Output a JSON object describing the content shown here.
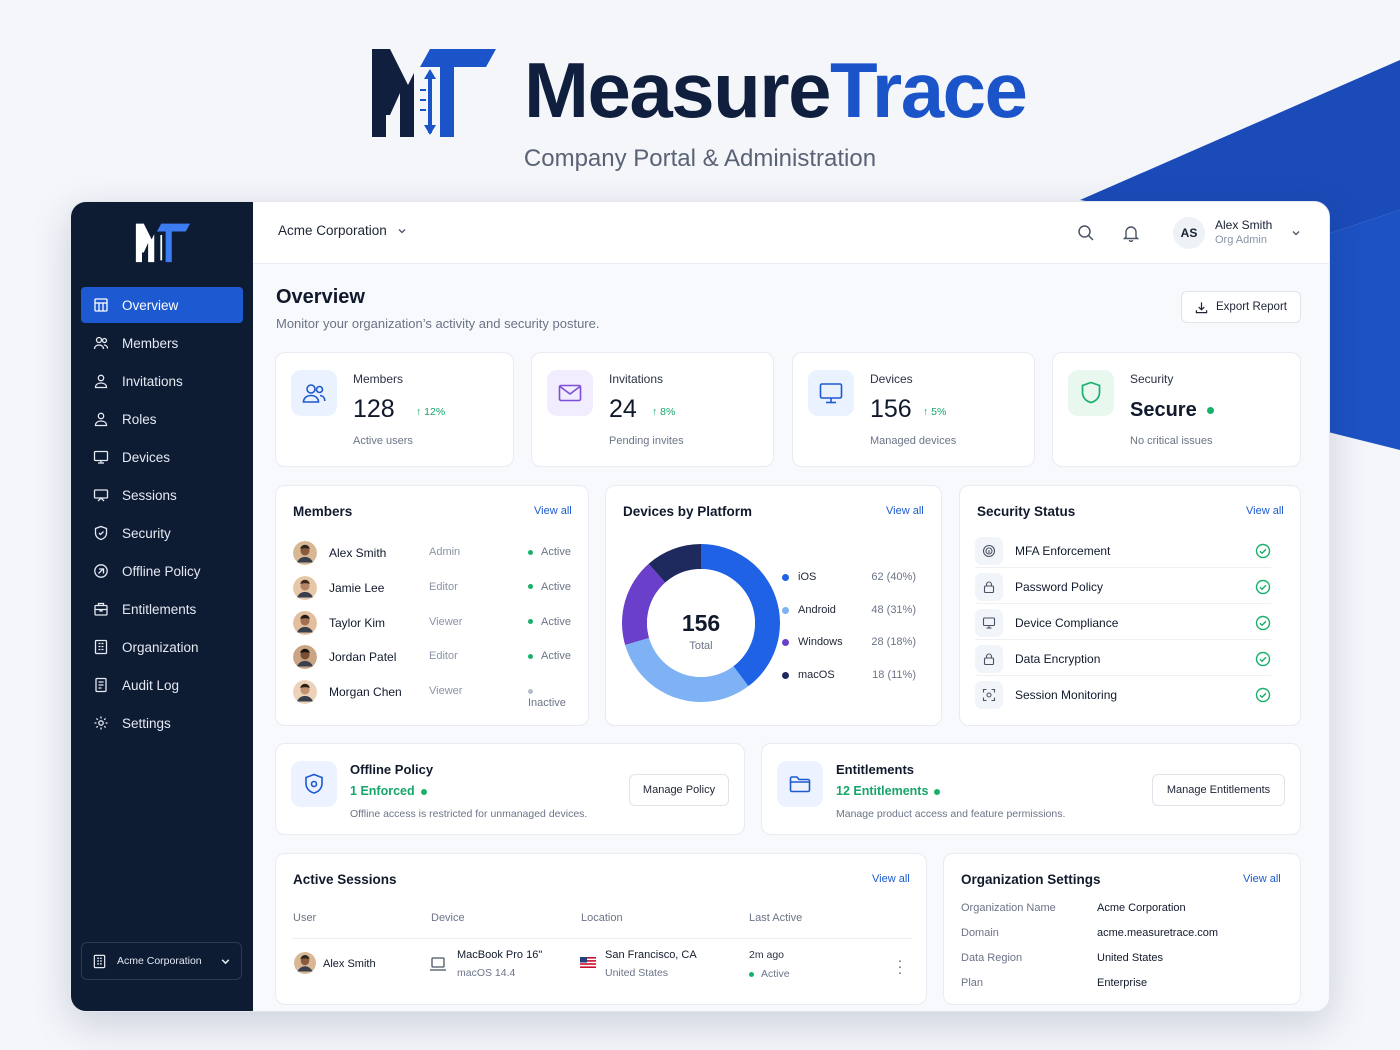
{
  "brand": {
    "name_part1": "Measure",
    "name_part2": "Trace",
    "tagline": "Company Portal & Administration"
  },
  "colors": {
    "brand_navy": "#0f1f3d",
    "brand_blue": "#1b54c9",
    "sidebar_bg": "#0d1b33",
    "active_nav": "#1d5ad1",
    "success": "#18b06b"
  },
  "sidebar": {
    "items": [
      {
        "label": "Overview",
        "icon": "grid-icon",
        "active": true
      },
      {
        "label": "Members",
        "icon": "users-icon"
      },
      {
        "label": "Invitations",
        "icon": "user-plus-icon"
      },
      {
        "label": "Roles",
        "icon": "user-icon"
      },
      {
        "label": "Devices",
        "icon": "monitor-icon"
      },
      {
        "label": "Sessions",
        "icon": "session-icon"
      },
      {
        "label": "Security",
        "icon": "shield-icon"
      },
      {
        "label": "Offline Policy",
        "icon": "offline-icon"
      },
      {
        "label": "Entitlements",
        "icon": "package-icon"
      },
      {
        "label": "Organization",
        "icon": "building-icon"
      },
      {
        "label": "Audit Log",
        "icon": "log-icon"
      },
      {
        "label": "Settings",
        "icon": "gear-icon"
      }
    ],
    "org_switcher": "Acme Corporation"
  },
  "topbar": {
    "org": "Acme Corporation",
    "user_initials": "AS",
    "user_name": "Alex Smith",
    "user_role": "Org Admin"
  },
  "page": {
    "title": "Overview",
    "subtitle": "Monitor your organization’s activity and security posture.",
    "export_label": "Export Report"
  },
  "stats": [
    {
      "label": "Members",
      "value": "128",
      "delta": "12%",
      "note": "Active users"
    },
    {
      "label": "Invitations",
      "value": "24",
      "delta": "8%",
      "note": "Pending invites"
    },
    {
      "label": "Devices",
      "value": "156",
      "delta": "5%",
      "note": "Managed devices"
    },
    {
      "label": "Security",
      "value": "Secure",
      "note": "No critical issues"
    }
  ],
  "members_card": {
    "title": "Members",
    "view_all": "View all",
    "rows": [
      {
        "name": "Alex Smith",
        "role": "Admin",
        "status": "Active"
      },
      {
        "name": "Jamie Lee",
        "role": "Editor",
        "status": "Active"
      },
      {
        "name": "Taylor Kim",
        "role": "Viewer",
        "status": "Active"
      },
      {
        "name": "Jordan Patel",
        "role": "Editor",
        "status": "Active"
      },
      {
        "name": "Morgan Chen",
        "role": "Viewer",
        "status": "Inactive"
      }
    ]
  },
  "devices_card": {
    "title": "Devices by Platform",
    "view_all": "View all",
    "total_value": "156",
    "total_label": "Total"
  },
  "chart_data": {
    "type": "pie",
    "title": "Devices by Platform",
    "categories": [
      "iOS",
      "Android",
      "Windows",
      "macOS"
    ],
    "values": [
      62,
      48,
      28,
      18
    ],
    "labels": [
      "62 (40%)",
      "48 (31%)",
      "28 (18%)",
      "18 (11%)"
    ],
    "colors": [
      "#1f62e6",
      "#7eb2f5",
      "#6a3fc9",
      "#1e2a5e"
    ],
    "legend": "right"
  },
  "security_card": {
    "title": "Security Status",
    "view_all": "View all",
    "items": [
      {
        "label": "MFA Enforcement",
        "icon": "fingerprint-icon"
      },
      {
        "label": "Password Policy",
        "icon": "lock-icon"
      },
      {
        "label": "Device Compliance",
        "icon": "monitor-icon"
      },
      {
        "label": "Data Encryption",
        "icon": "lock-icon"
      },
      {
        "label": "Session Monitoring",
        "icon": "scan-icon"
      }
    ]
  },
  "offline_policy": {
    "title": "Offline Policy",
    "count": "1",
    "status": "Enforced",
    "description": "Offline access is restricted for unmanaged devices.",
    "button": "Manage Policy"
  },
  "entitlements": {
    "title": "Entitlements",
    "count": "12",
    "status": "Entitlements",
    "description": "Manage product access and feature permissions.",
    "button": "Manage Entitlements"
  },
  "sessions_card": {
    "title": "Active Sessions",
    "view_all": "View all",
    "columns": [
      "User",
      "Device",
      "Location",
      "Last Active"
    ],
    "rows": [
      {
        "user": "Alex Smith",
        "device": "MacBook Pro 16\"",
        "device_os": "macOS 14.4",
        "location": "San Francisco, CA",
        "country": "United States",
        "last_active": "2m ago",
        "status": "Active"
      }
    ]
  },
  "org_settings": {
    "title": "Organization Settings",
    "view_all": "View all",
    "rows": [
      {
        "key": "Organization Name",
        "value": "Acme Corporation"
      },
      {
        "key": "Domain",
        "value": "acme.measuretrace.com"
      },
      {
        "key": "Data Region",
        "value": "United States"
      },
      {
        "key": "Plan",
        "value": "Enterprise"
      }
    ]
  }
}
